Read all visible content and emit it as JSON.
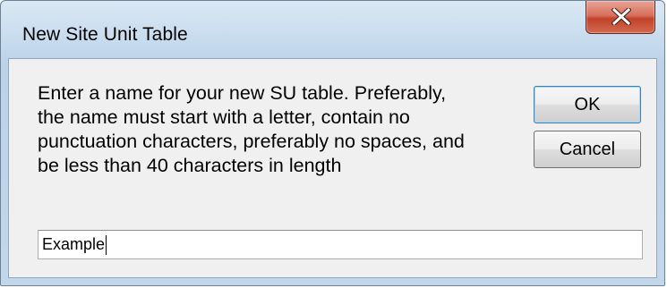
{
  "window": {
    "title": "New Site Unit Table",
    "close_icon": "close-icon"
  },
  "dialog": {
    "prompt": "Enter a name for your new SU table.  Preferably,\nthe name must start with a letter, contain no\npunctuation characters, preferably no spaces, and\nbe less than 40 characters in length",
    "ok_label": "OK",
    "cancel_label": "Cancel",
    "input_value": "Example"
  },
  "colors": {
    "frame": "#c7dbee",
    "client": "#f0f0f0",
    "close_button": "#c2412a",
    "ok_focus_border": "#3c7fb1"
  }
}
